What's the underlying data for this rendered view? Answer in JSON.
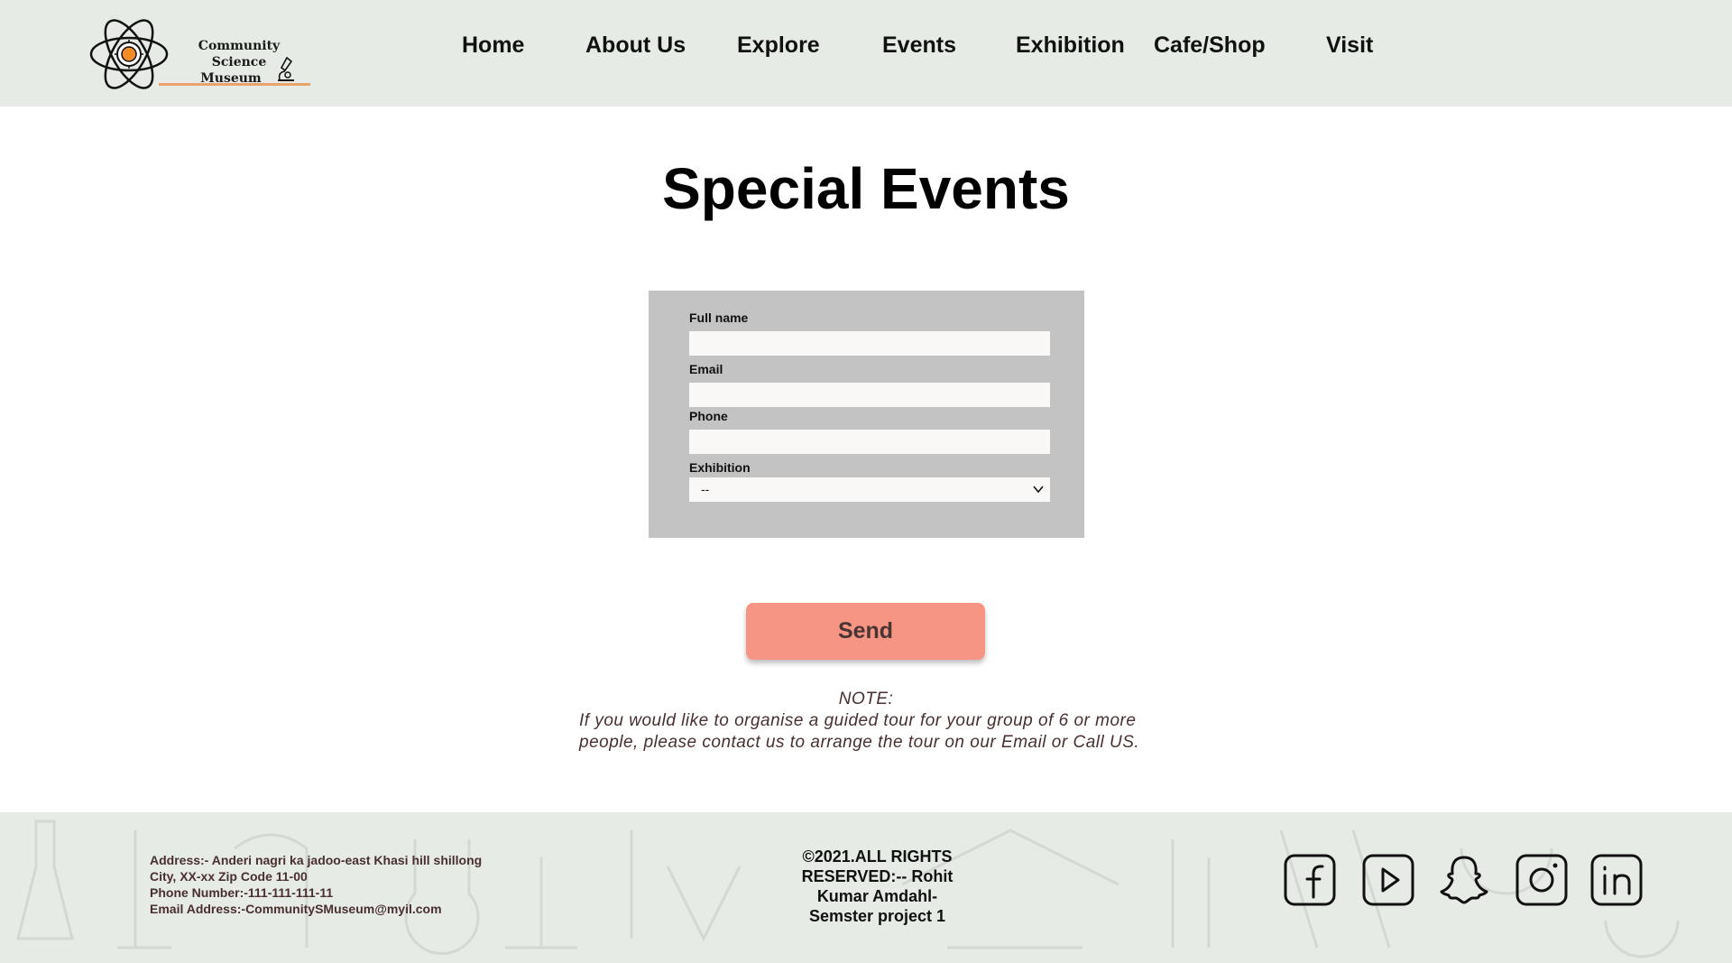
{
  "brand": {
    "name_line1": "Community Science",
    "name_line2": "Museum"
  },
  "nav": {
    "home": "Home",
    "about": "About  Us",
    "explore": "Explore",
    "events": "Events",
    "exhibition": "Exhibition",
    "cafe": "Cafe/Shop",
    "visit": "Visit"
  },
  "page": {
    "title": "Special Events"
  },
  "form": {
    "full_name_label": "Full name",
    "full_name_value": "",
    "email_label": "Email",
    "email_value": "",
    "phone_label": "Phone",
    "phone_value": "",
    "exhibition_label": "Exhibition",
    "exhibition_selected": "--",
    "send_label": "Send"
  },
  "note": {
    "title": "NOTE:",
    "line1": "If you would like to organise a guided tour for your group of 6 or more",
    "line2": "people, please contact us to arrange the tour on our Email or Call US."
  },
  "footer": {
    "address_line1": "Address:- Anderi nagri ka jadoo-east Khasi hill shillong",
    "address_line2": "City, XX-xx Zip Code 11-00",
    "phone": "Phone Number:-111-111-111-11",
    "email": "Email Address:-CommunitySMuseum@myil.com",
    "copy_line1": "©2021.ALL RIGHTS",
    "copy_line2": "RESERVED:-- Rohit",
    "copy_line3": "Kumar Amdahl-",
    "copy_line4": "Semster project 1"
  },
  "social_icons": [
    "facebook-icon",
    "youtube-icon",
    "snapchat-icon",
    "instagram-icon",
    "linkedin-icon"
  ],
  "colors": {
    "header_bg": "#e6ebe6",
    "form_bg": "#c3c3c3",
    "send_button": "#f79584",
    "note_text": "#4a2f2f",
    "logo_accent": "#f28c28"
  }
}
